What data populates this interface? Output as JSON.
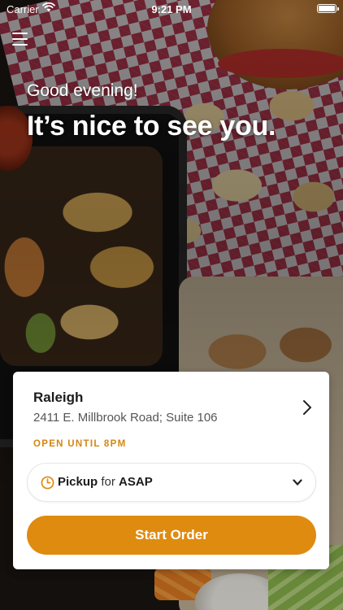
{
  "status_bar": {
    "carrier": "Carrier",
    "time": "9:21 PM"
  },
  "hero": {
    "greeting": "Good evening!",
    "headline": "It’s nice to see you."
  },
  "location": {
    "name": "Raleigh",
    "address": "2411 E. Millbrook Road; Suite 106",
    "hours": "OPEN UNTIL 8PM"
  },
  "order_mode": {
    "mode": "Pickup",
    "connector": "for",
    "time": "ASAP"
  },
  "actions": {
    "start_order": "Start Order"
  },
  "colors": {
    "accent": "#df8b10",
    "hours_text": "#d4860f",
    "card_bg": "#ffffff"
  },
  "icons": {
    "menu": "hamburger-menu-icon",
    "wifi": "wifi-icon",
    "battery": "battery-icon",
    "location_arrow": "chevron-right-icon",
    "clock": "clock-icon",
    "dropdown": "chevron-down-icon"
  }
}
